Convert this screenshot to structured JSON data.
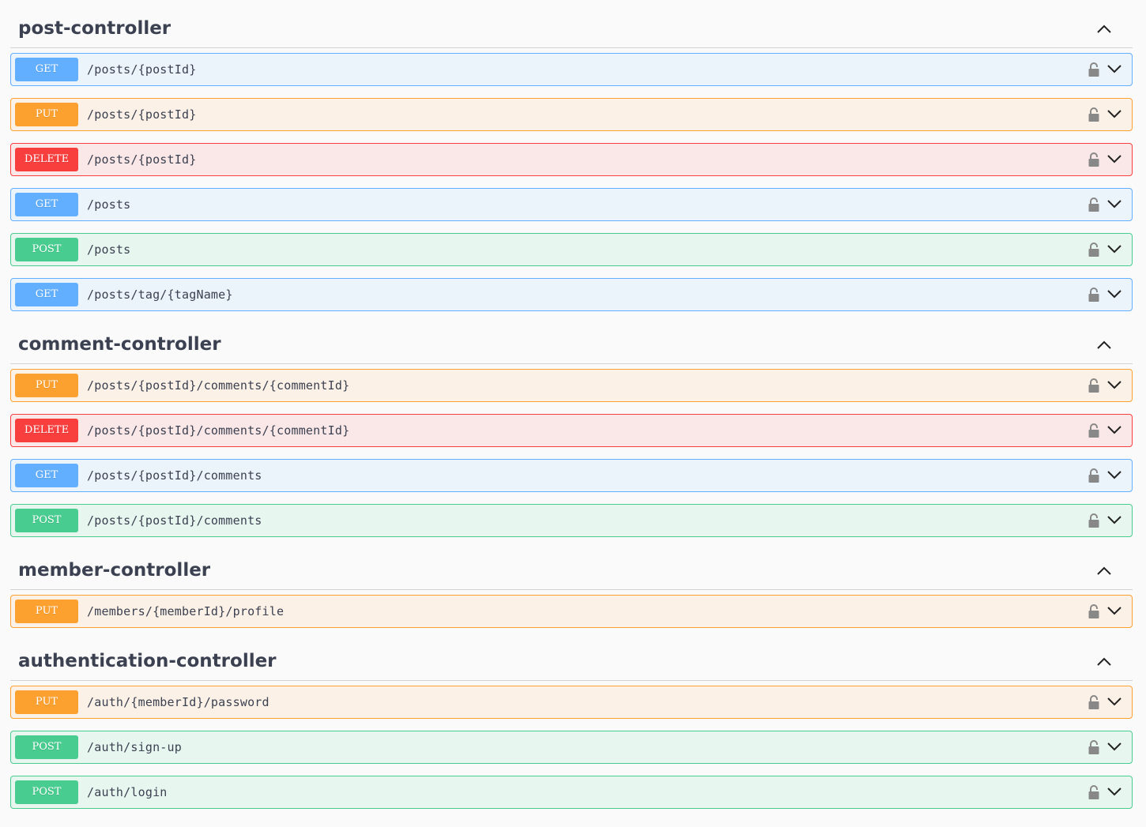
{
  "sections": [
    {
      "title": "post-controller",
      "operations": [
        {
          "method": "GET",
          "path": "/posts/{postId}"
        },
        {
          "method": "PUT",
          "path": "/posts/{postId}"
        },
        {
          "method": "DELETE",
          "path": "/posts/{postId}"
        },
        {
          "method": "GET",
          "path": "/posts"
        },
        {
          "method": "POST",
          "path": "/posts"
        },
        {
          "method": "GET",
          "path": "/posts/tag/{tagName}"
        }
      ]
    },
    {
      "title": "comment-controller",
      "operations": [
        {
          "method": "PUT",
          "path": "/posts/{postId}/comments/{commentId}"
        },
        {
          "method": "DELETE",
          "path": "/posts/{postId}/comments/{commentId}"
        },
        {
          "method": "GET",
          "path": "/posts/{postId}/comments"
        },
        {
          "method": "POST",
          "path": "/posts/{postId}/comments"
        }
      ]
    },
    {
      "title": "member-controller",
      "operations": [
        {
          "method": "PUT",
          "path": "/members/{memberId}/profile"
        }
      ]
    },
    {
      "title": "authentication-controller",
      "operations": [
        {
          "method": "PUT",
          "path": "/auth/{memberId}/password"
        },
        {
          "method": "POST",
          "path": "/auth/sign-up"
        },
        {
          "method": "POST",
          "path": "/auth/login"
        }
      ]
    }
  ],
  "colors": {
    "get": "#61affe",
    "put": "#fca130",
    "delete": "#f93e3e",
    "post": "#49cc90"
  },
  "icons": {
    "section_toggle": "chevron-up-icon",
    "operation_lock": "lock-icon",
    "operation_toggle": "chevron-down-icon"
  }
}
